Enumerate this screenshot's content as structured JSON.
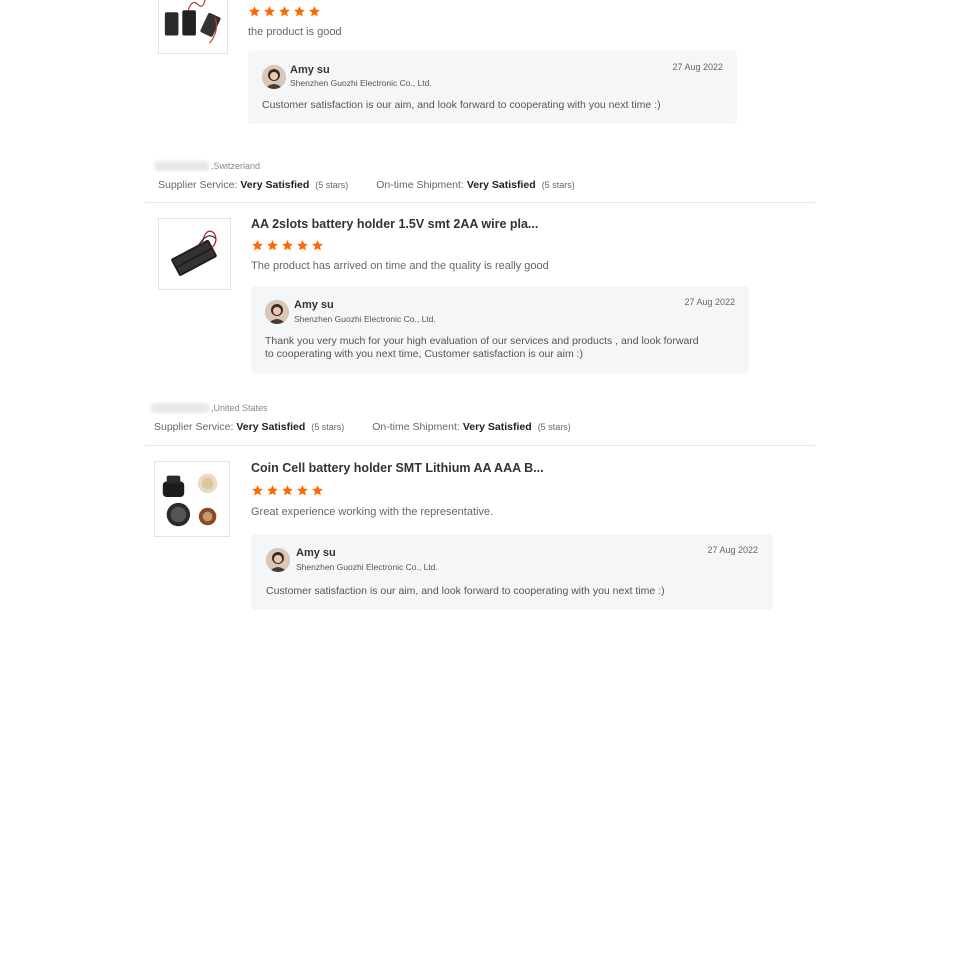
{
  "theme": {
    "star_color": "#ff6a00"
  },
  "reviews": [
    {
      "product_title": "",
      "rating": 5,
      "text": "the product is good",
      "reply": {
        "name": "Amy su",
        "company": "Shenzhen Guozhi Electronic Co., Ltd.",
        "date": "27 Aug 2022",
        "message": "Customer satisfaction is our aim, and look forward to cooperating with you next time  :)"
      }
    },
    {
      "country": ",Switzerland",
      "supplier_service_label": "Supplier Service:",
      "supplier_service_value": "Very Satisfied",
      "supplier_service_stars": "(5 stars)",
      "shipment_label": "On-time Shipment:",
      "shipment_value": "Very Satisfied",
      "shipment_stars": "(5 stars)",
      "product_title": "AA 2slots battery holder 1.5V smt 2AA wire pla...",
      "rating": 5,
      "text": "The product has arrived on time and the quality is really good",
      "reply": {
        "name": "Amy su",
        "company": "Shenzhen Guozhi Electronic Co., Ltd.",
        "date": "27 Aug 2022",
        "message": "Thank you very much for your high evaluation of our services and products , and look forward to cooperating with you next time, Customer satisfaction is our aim :)"
      }
    },
    {
      "country": ",United States",
      "supplier_service_label": "Supplier Service:",
      "supplier_service_value": "Very Satisfied",
      "supplier_service_stars": "(5 stars)",
      "shipment_label": "On-time Shipment:",
      "shipment_value": "Very Satisfied",
      "shipment_stars": "(5 stars)",
      "product_title": "Coin Cell battery holder SMT Lithium AA AAA B...",
      "rating": 5,
      "text": "Great experience working with the representative.",
      "reply": {
        "name": "Amy su",
        "company": "Shenzhen Guozhi Electronic Co., Ltd.",
        "date": "27 Aug 2022",
        "message": "Customer satisfaction is our aim, and look forward to cooperating with you next time  :)"
      }
    }
  ]
}
